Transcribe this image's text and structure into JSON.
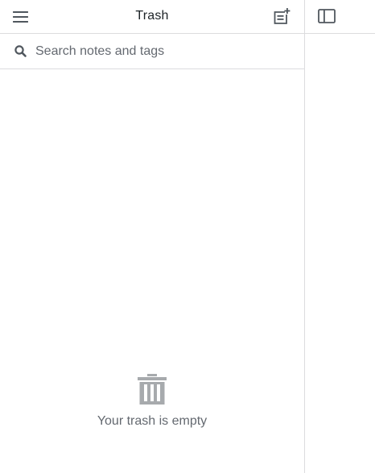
{
  "header": {
    "title": "Trash",
    "menu_icon": "menu-icon",
    "new_note_icon": "new-note-icon",
    "sidebar_toggle_icon": "sidebar-toggle-icon"
  },
  "search": {
    "placeholder": "Search notes and tags",
    "value": "",
    "icon": "search-icon"
  },
  "empty_state": {
    "icon": "trash-icon",
    "message": "Your trash is empty"
  },
  "colors": {
    "text": "#1d2327",
    "muted": "#646970",
    "icon": "#50575e",
    "icon_light": "#a7aaad",
    "divider": "#dcdcde",
    "background": "#ffffff"
  }
}
